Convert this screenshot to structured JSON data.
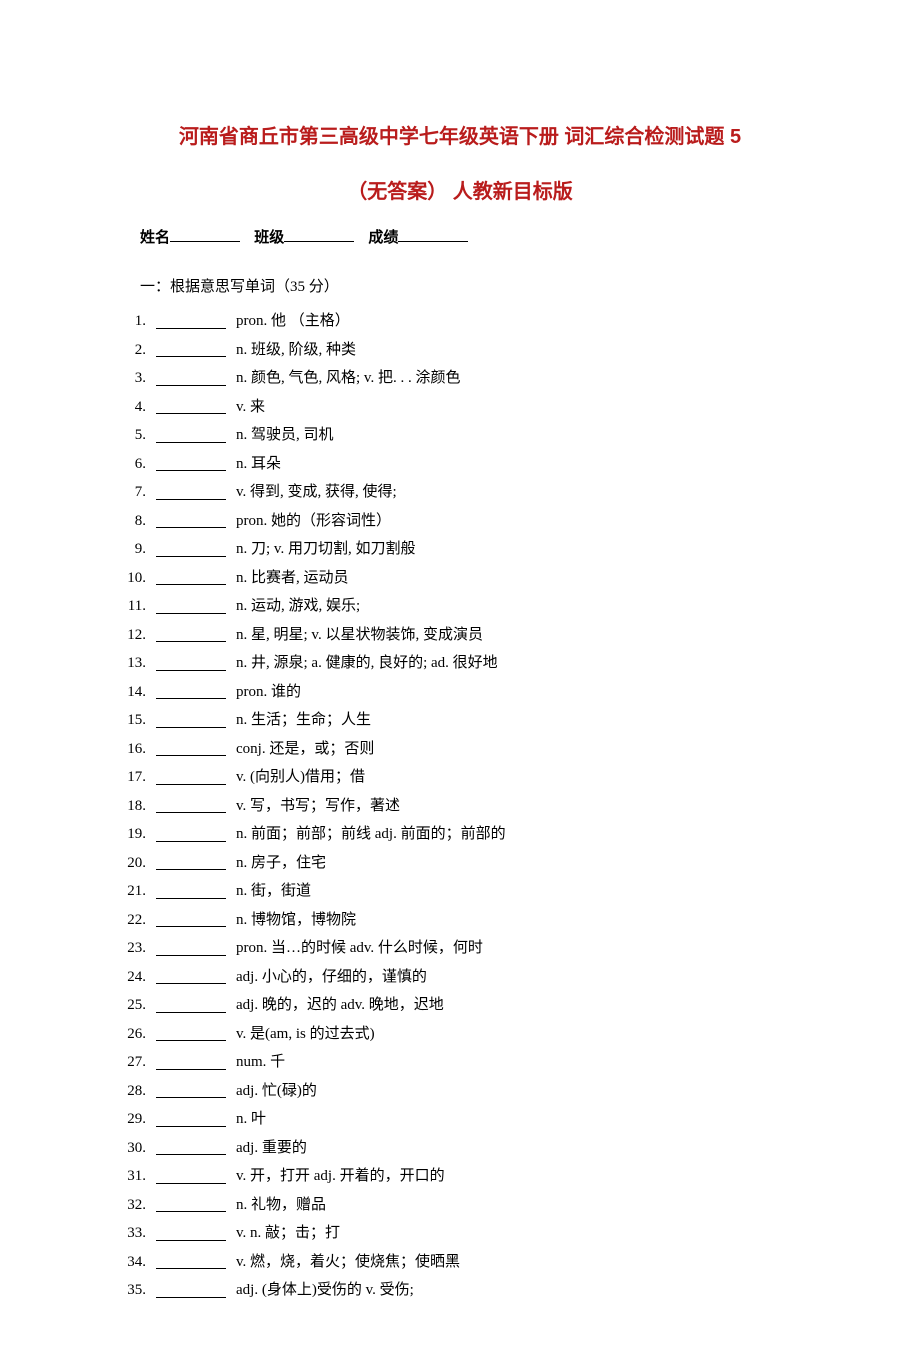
{
  "title_line1": "河南省商丘市第三高级中学七年级英语下册 词汇综合检测试题 5",
  "title_line2": "（无答案） 人教新目标版",
  "info": {
    "name_label": "姓名",
    "class_label": "班级",
    "score_label": "成绩"
  },
  "section1_heading": "一：根据意思写单词（35 分）",
  "items": [
    "pron. 他 （主格）",
    "n. 班级, 阶级, 种类",
    "n. 颜色, 气色, 风格; v. 把. . . 涂颜色",
    "v. 来",
    "n. 驾驶员, 司机",
    "n. 耳朵",
    "v. 得到, 变成, 获得, 使得;",
    "pron. 她的（形容词性）",
    "n. 刀; v. 用刀切割, 如刀割般",
    "n. 比赛者, 运动员",
    "n. 运动, 游戏, 娱乐;",
    "n. 星, 明星; v. 以星状物装饰, 变成演员",
    "n. 井, 源泉; a. 健康的, 良好的; ad. 很好地",
    "pron. 谁的",
    "n. 生活；生命；人生",
    " conj. 还是，或；否则",
    "v. (向别人)借用；借",
    "v. 写，书写；写作，著述",
    "n. 前面；前部；前线 adj. 前面的；前部的",
    "n. 房子，住宅",
    "n. 街，街道",
    "n. 博物馆，博物院",
    "pron. 当…的时候 adv. 什么时候，何时",
    "adj. 小心的，仔细的，谨慎的",
    "adj. 晚的，迟的 adv. 晚地，迟地",
    "v. 是(am, is 的过去式)",
    "num. 千",
    "adj. 忙(碌)的",
    "n. 叶",
    "adj. 重要的",
    "v. 开，打开 adj. 开着的，开口的",
    "n. 礼物，赠品",
    "v. n. 敲；击；打",
    "v. 燃，烧，着火；使烧焦；使晒黑",
    "adj. (身体上)受伤的  v. 受伤;"
  ]
}
